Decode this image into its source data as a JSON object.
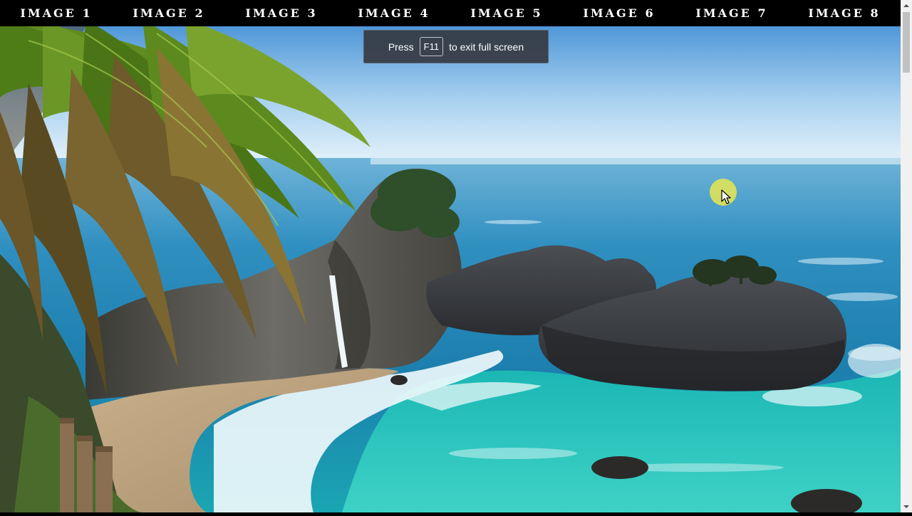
{
  "nav": {
    "items": [
      {
        "label": "IMAGE 1"
      },
      {
        "label": "IMAGE 2"
      },
      {
        "label": "IMAGE 3"
      },
      {
        "label": "IMAGE 4"
      },
      {
        "label": "IMAGE 5"
      },
      {
        "label": "IMAGE 6"
      },
      {
        "label": "IMAGE 7"
      },
      {
        "label": "IMAGE 8"
      }
    ]
  },
  "fullscreen_notice": {
    "before": "Press",
    "key": "F11",
    "after": "to exit full screen"
  },
  "scene": {
    "subject": "coastal-waterfall-landscape"
  },
  "colors": {
    "nav_background": "#000000",
    "nav_text": "#ffffff",
    "toast_background": "#353a42",
    "cursor_highlight": "#e6e850",
    "scrollbar_track": "#f1f1f1",
    "scrollbar_thumb": "#c1c1c1"
  },
  "icons": {
    "cursor": "mouse-pointer-icon",
    "scroll_up": "scroll-up-arrow-icon",
    "scroll_down": "scroll-down-arrow-icon"
  }
}
